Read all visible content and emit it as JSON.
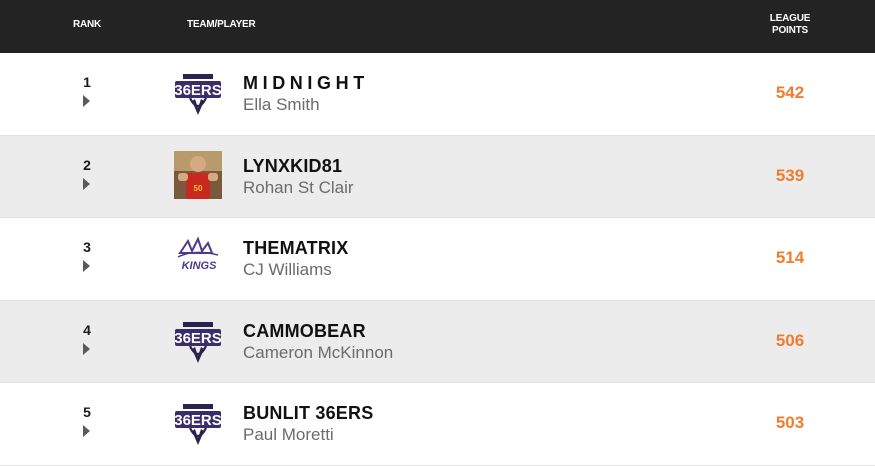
{
  "header": {
    "rank_label": "RANK",
    "team_label": "TEAM/PLAYER",
    "points_label_line1": "LEAGUE",
    "points_label_line2": "POINTS"
  },
  "colors": {
    "header_bg": "#232323",
    "points": "#f07d2e",
    "alt_row": "#ececec"
  },
  "rows": [
    {
      "rank": "1",
      "team": "MIDNIGHT",
      "player": "Ella Smith",
      "points": "542",
      "logo": "adelaide-36ers-logo"
    },
    {
      "rank": "2",
      "team": "LYNXKID81",
      "player": "Rohan St Clair",
      "points": "539",
      "logo": "player-photo-avatar"
    },
    {
      "rank": "3",
      "team": "THEMATRIX",
      "player": "CJ Williams",
      "points": "514",
      "logo": "sydney-kings-logo"
    },
    {
      "rank": "4",
      "team": "CAMMOBEAR",
      "player": "Cameron McKinnon",
      "points": "506",
      "logo": "adelaide-36ers-logo"
    },
    {
      "rank": "5",
      "team": "BUNLIT 36ERS",
      "player": "Paul Moretti",
      "points": "503",
      "logo": "adelaide-36ers-logo"
    }
  ]
}
